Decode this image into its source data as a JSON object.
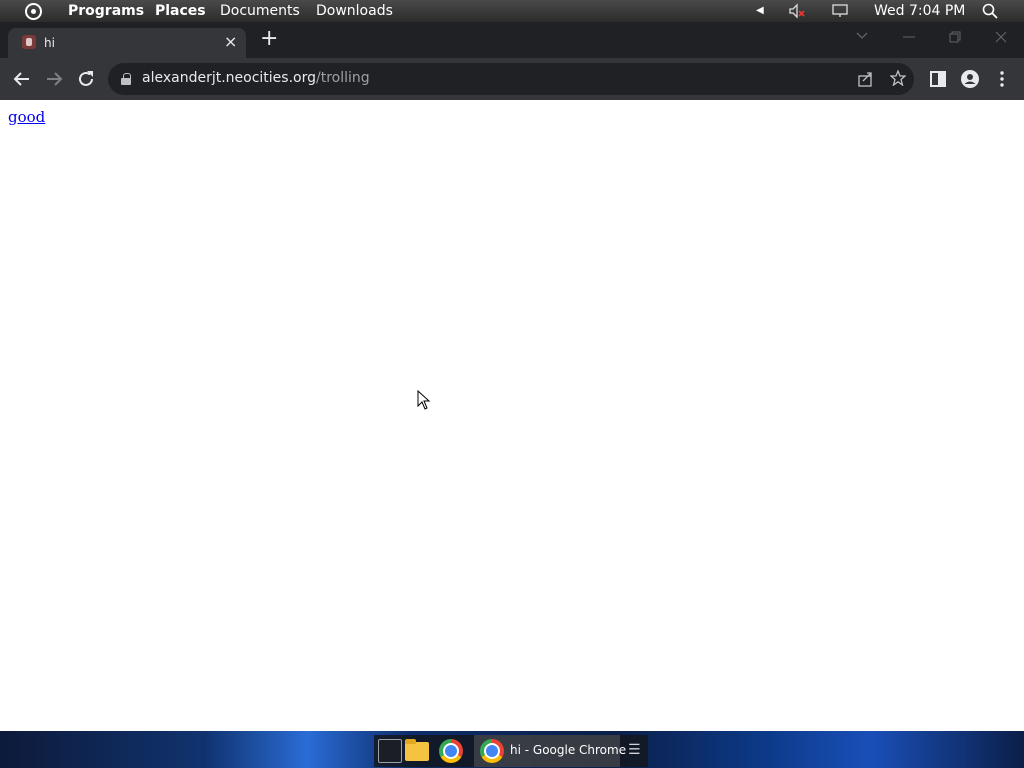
{
  "top_panel": {
    "menus": [
      "Programs",
      "Places",
      "Documents",
      "Downloads"
    ],
    "clock": "Wed 7:04 PM"
  },
  "browser": {
    "tab": {
      "title": "hi",
      "close": "×"
    },
    "new_tab": "+",
    "omnibox": {
      "host": "alexanderjt.neocities.org",
      "path": "/trolling"
    }
  },
  "page": {
    "link_text": "good"
  },
  "taskbar": {
    "active_window_label": "hi - Google Chrome"
  }
}
